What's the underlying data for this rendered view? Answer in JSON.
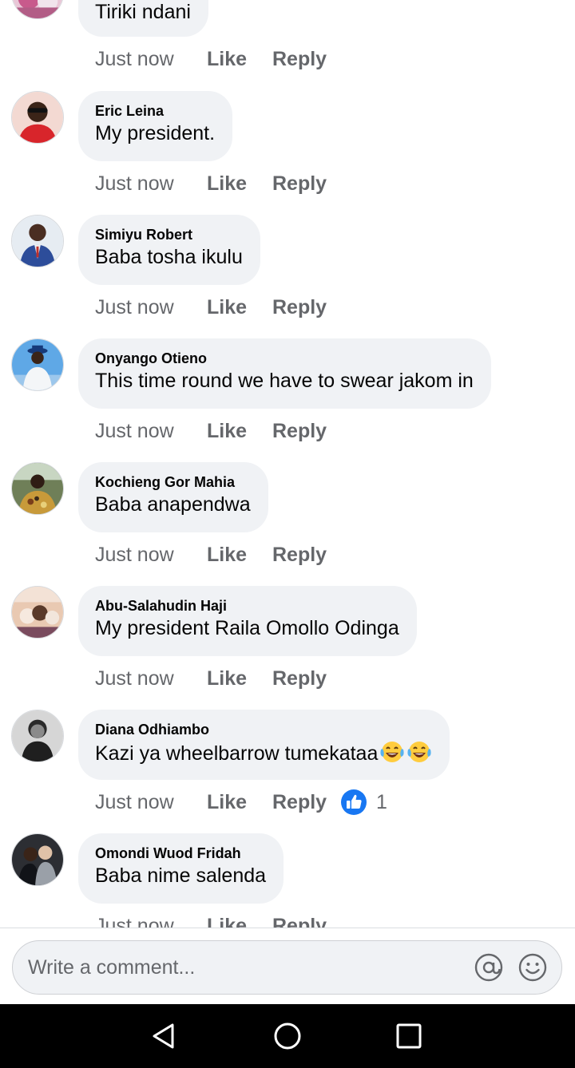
{
  "action_labels": {
    "like": "Like",
    "reply": "Reply"
  },
  "comments": [
    {
      "author": "",
      "text": "Tiriki ndani",
      "time": "Just now",
      "avatar": "avatar-pink-photo"
    },
    {
      "author": "Eric Leina",
      "text": "My president.",
      "time": "Just now",
      "avatar": "avatar-man-red-shirt-sunglasses"
    },
    {
      "author": "Simiyu Robert",
      "text": "Baba tosha ikulu",
      "time": "Just now",
      "avatar": "avatar-man-suit"
    },
    {
      "author": "Onyango Otieno",
      "text": "This time round we have to swear jakom in",
      "time": "Just now",
      "avatar": "avatar-man-blue-hat-sky"
    },
    {
      "author": "Kochieng Gor Mahia",
      "text": "Baba anapendwa",
      "time": "Just now",
      "avatar": "avatar-man-patterned-shirt"
    },
    {
      "author": "Abu-Salahudin Haji",
      "text": "My president Raila Omollo Odinga",
      "time": "Just now",
      "avatar": "avatar-children-group"
    },
    {
      "author": "Diana Odhiambo",
      "text": "Kazi ya wheelbarrow tumekataa",
      "emojis": [
        "face-with-tears-of-joy",
        "face-with-tears-of-joy"
      ],
      "time": "Just now",
      "reaction": {
        "type": "like",
        "count": "1"
      },
      "avatar": "avatar-woman-black-white"
    },
    {
      "author": "Omondi Wuod Fridah",
      "text": "Baba nime salenda",
      "time": "Just now",
      "avatar": "avatar-couple-dark"
    }
  ],
  "composer": {
    "placeholder": "Write a comment...",
    "icons": [
      "mention-icon",
      "emoji-icon"
    ]
  },
  "navbar": {
    "buttons": [
      "back-triangle",
      "home-circle",
      "recents-square"
    ]
  },
  "colors": {
    "bubble": "#f0f2f5",
    "meta_text": "#65676b",
    "like_blue": "#1877f2",
    "nav_bg": "#000000"
  }
}
